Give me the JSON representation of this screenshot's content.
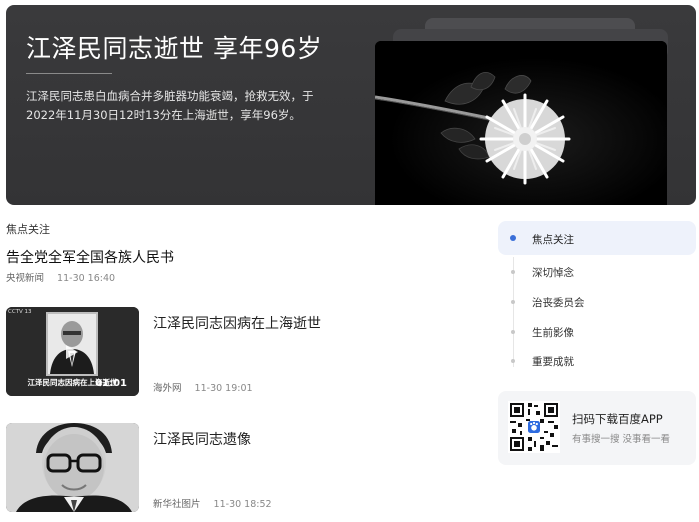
{
  "hero": {
    "title": "江泽民同志逝世 享年96岁",
    "description": "江泽民同志患白血病合并多脏器功能衰竭，抢救无效，于2022年11月30日12时13分在上海逝世，享年96岁。",
    "image_icon": "chrysanthemum-photo"
  },
  "feed": {
    "section_label": "焦点关注",
    "headline": {
      "title": "告全党全军全国各族人民书",
      "source": "央视新闻",
      "time": "11-30 16:40"
    },
    "cards": [
      {
        "title": "江泽民同志因病在上海逝世",
        "source": "海外网",
        "time": "11-30 19:01",
        "thumb_caption": "江泽民同志因病在上海逝世",
        "thumb_badge": "CCTV 13",
        "duration": "01:01",
        "thumb_icon": "video-thumbnail"
      },
      {
        "title": "江泽民同志遗像",
        "source": "新华社图片",
        "time": "11-30 18:52",
        "thumb_icon": "portrait-photo"
      }
    ]
  },
  "sidebar": {
    "nav": [
      {
        "label": "焦点关注",
        "active": true
      },
      {
        "label": "深切悼念",
        "active": false
      },
      {
        "label": "治丧委员会",
        "active": false
      },
      {
        "label": "生前影像",
        "active": false
      },
      {
        "label": "重要成就",
        "active": false
      }
    ],
    "app_promo": {
      "title": "扫码下载百度APP",
      "subtitle": "有事搜一搜 没事看一看",
      "qr_icon": "qr-code"
    }
  },
  "colors": {
    "hero_bg": "#38383a",
    "accent": "#3a6fd8",
    "active_nav_bg": "#eef2fb"
  }
}
